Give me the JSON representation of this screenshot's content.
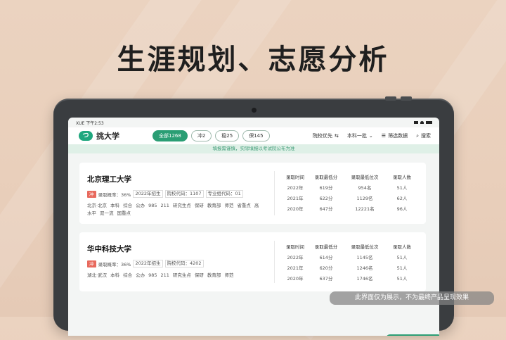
{
  "headline": "生涯规划、志愿分析",
  "status_bar": {
    "left": "XUE 下午2:53"
  },
  "app": {
    "name": "挑大学",
    "logo_glyph": "つ"
  },
  "filter_chips": [
    {
      "label": "全部1268",
      "active": true
    },
    {
      "label": "冲2",
      "active": false
    },
    {
      "label": "稳25",
      "active": false
    },
    {
      "label": "保145",
      "active": false
    }
  ],
  "tools": {
    "sort_label": "院校优先",
    "batch_label": "本科一批",
    "filter_label": "筛选数据",
    "search_label": "搜索"
  },
  "tip": "填报需谨慎，实际填报以考试院公布为准",
  "table_headers": [
    "录取时间",
    "录取最低分",
    "录取最低位次",
    "录取人数"
  ],
  "cards": [
    {
      "name": "北京理工大学",
      "badge": "冲",
      "probability": "录取概率：36%",
      "meta": [
        "2022年招生",
        "院校代码：1107",
        "专业组代码：01"
      ],
      "tags": [
        "北京·北京",
        "本科",
        "综合",
        "公办",
        "985",
        "211",
        "研究生点",
        "保研",
        "教育部",
        "师范",
        "省重点",
        "高水平",
        "双一流",
        "国重点"
      ],
      "rows": [
        [
          "2022年",
          "619分",
          "954名",
          "51人"
        ],
        [
          "2021年",
          "622分",
          "1129名",
          "62人"
        ],
        [
          "2020年",
          "647分",
          "12221名",
          "96人"
        ]
      ]
    },
    {
      "name": "华中科技大学",
      "badge": "冲",
      "probability": "录取概率：36%",
      "meta": [
        "2022年招生",
        "院校代码：4202"
      ],
      "tags": [
        "湖北·武汉",
        "本科",
        "综合",
        "公办",
        "985",
        "211",
        "研究生点",
        "保研",
        "教育部",
        "师范"
      ],
      "rows": [
        [
          "2022年",
          "614分",
          "1145名",
          "51人"
        ],
        [
          "2021年",
          "620分",
          "1246名",
          "51人"
        ],
        [
          "2020年",
          "637分",
          "1746名",
          "51人"
        ]
      ]
    }
  ],
  "disclaimer": "此界面仅为展示，不为最终产品呈现效果",
  "colors": {
    "accent": "#2a9e74",
    "badge": "#e86a5e",
    "background": "#ebd3c0"
  }
}
